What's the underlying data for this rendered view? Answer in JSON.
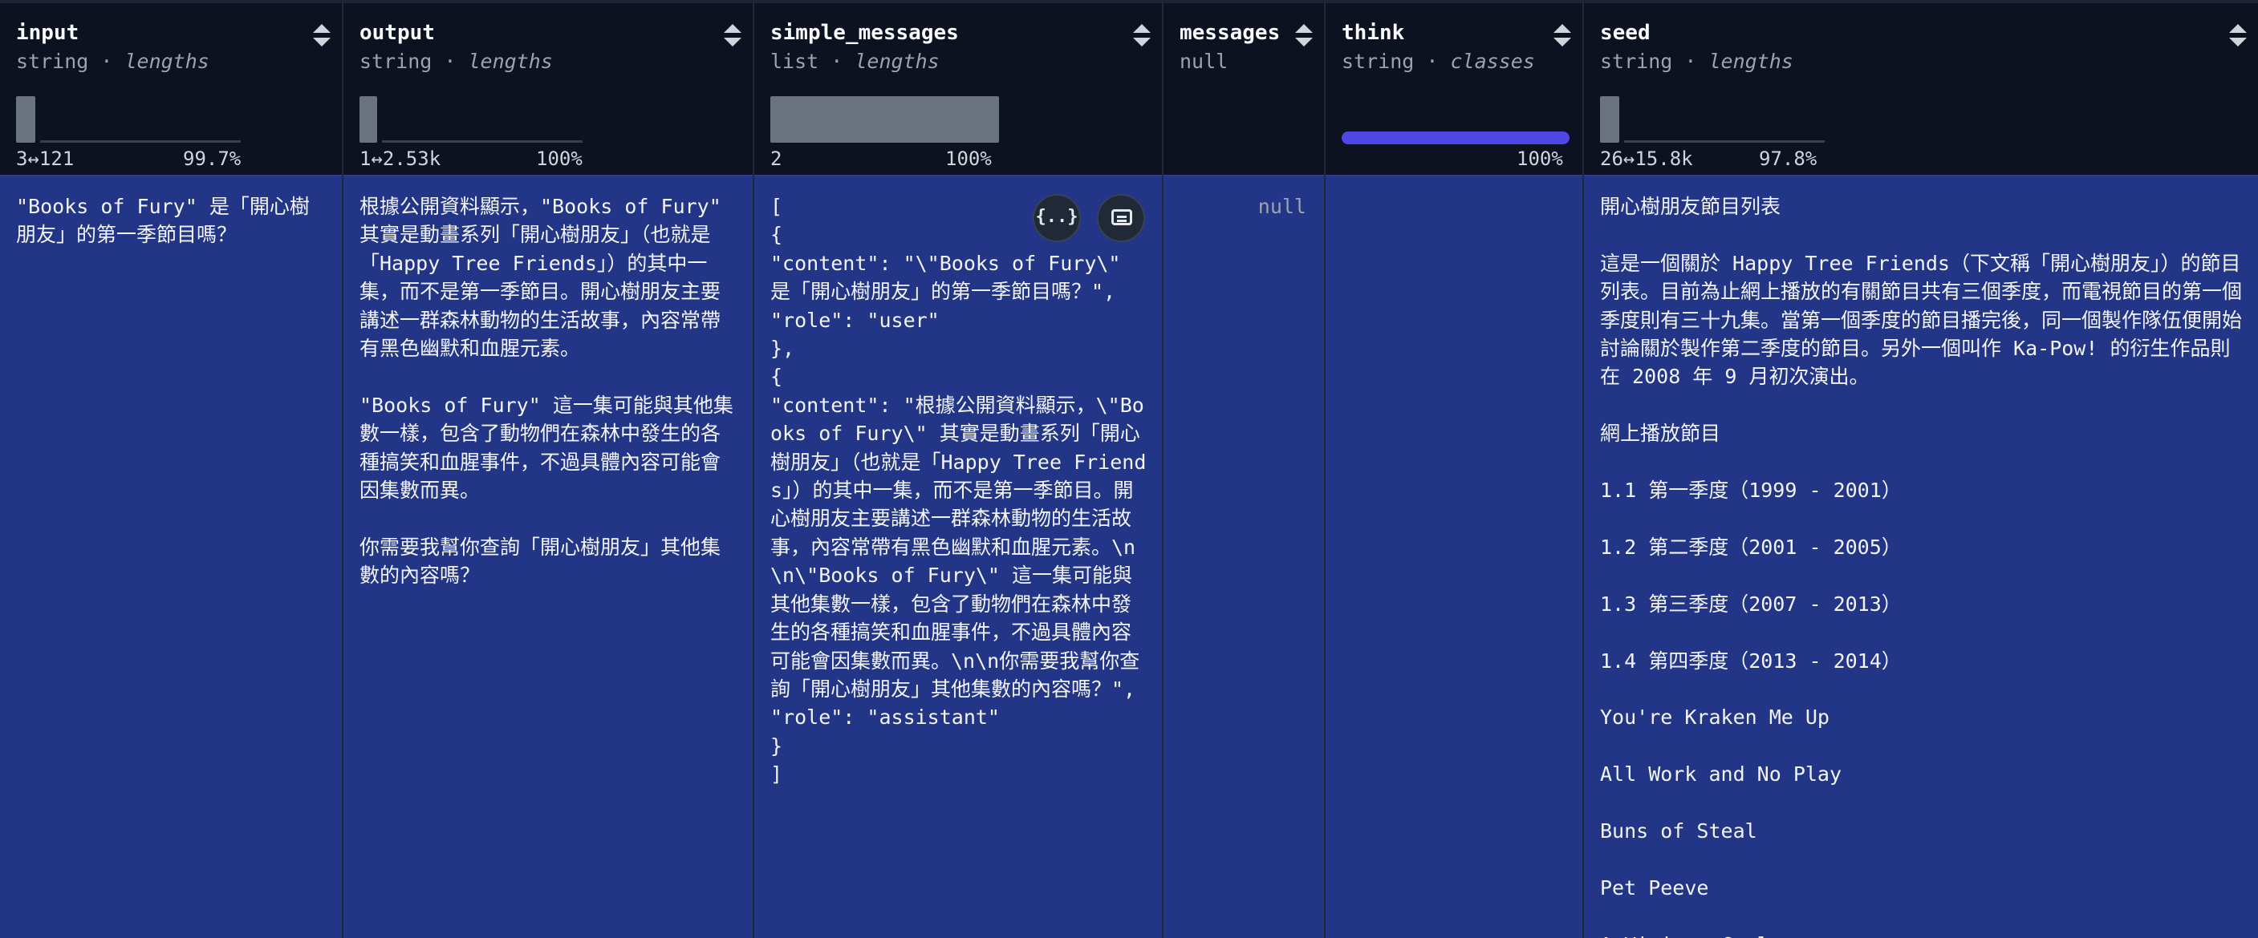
{
  "columns": [
    {
      "name": "input",
      "type": "string",
      "kind": "lengths",
      "range": "3↔121",
      "percent": "99.7%"
    },
    {
      "name": "output",
      "type": "string",
      "kind": "lengths",
      "range": "1↔2.53k",
      "percent": "100%"
    },
    {
      "name": "simple_messages",
      "type": "list",
      "kind": "lengths",
      "range": "2",
      "percent": "100%"
    },
    {
      "name": "messages",
      "type": "null",
      "kind": "",
      "range": "",
      "percent": ""
    },
    {
      "name": "think",
      "type": "string",
      "kind": "classes",
      "range": "",
      "percent": "100%"
    },
    {
      "name": "seed",
      "type": "string",
      "kind": "lengths",
      "range": "26↔15.8k",
      "percent": "97.8%"
    }
  ],
  "row": {
    "input": "\"Books of Fury\" 是「開心樹朋友」的第一季節目嗎？",
    "output": "根據公開資料顯示，\"Books of Fury\" 其實是動畫系列「開心樹朋友」（也就是「Happy Tree Friends」）的其中一集，而不是第一季節目。開心樹朋友主要講述一群森林動物的生活故事，內容常帶有黑色幽默和血腥元素。\n\n\"Books of Fury\" 這一集可能與其他集數一樣，包含了動物們在森林中發生的各種搞笑和血腥事件，不過具體內容可能會因集數而異。\n\n你需要我幫你查詢「開心樹朋友」其他集數的內容嗎？",
    "simple_messages": "[\n{\n\"content\": \"\\\"Books of Fury\\\" 是「開心樹朋友」的第一季節目嗎？\",\n\"role\": \"user\"\n},\n{\n\"content\": \"根據公開資料顯示，\\\"Books of Fury\\\" 其實是動畫系列「開心樹朋友」（也就是「Happy Tree Friends」）的其中一集，而不是第一季節目。開心樹朋友主要講述一群森林動物的生活故事，內容常帶有黑色幽默和血腥元素。\\n\\n\\\"Books of Fury\\\" 這一集可能與其他集數一樣，包含了動物們在森林中發生的各種搞笑和血腥事件，不過具體內容可能會因集數而異。\\n\\n你需要我幫你查詢「開心樹朋友」其他集數的內容嗎？\",\n\"role\": \"assistant\"\n}\n]",
    "messages": "null",
    "think": "",
    "seed": "開心樹朋友節目列表\n\n這是一個關於 Happy Tree Friends（下文稱「開心樹朋友」）的節目列表。目前為止網上播放的有關節目共有三個季度，而電視節目的第一個季度則有三十九集。當第一個季度的節目播完後，同一個製作隊伍便開始討論關於製作第二季度的節目。另外一個叫作 Ka-Pow! 的衍生作品則在 2008 年 9 月初次演出。\n\n網上播放節目\n\n1.1 第一季度（1999 - 2001）\n\n1.2 第二季度（2001 - 2005）\n\n1.3 第三季度（2007 - 2013）\n\n1.4 第四季度（2013 - 2014）\n\nYou're Kraken Me Up\n\nAll Work and No Play\n\nBuns of Steal\n\nPet Peeve\n\nA Vicious Cycle"
  },
  "buttons": {
    "json_icon": "{..}"
  },
  "colors": {
    "cell_bg": "#223587",
    "header_bg": "#0d1220",
    "accent": "#4f46e5"
  }
}
